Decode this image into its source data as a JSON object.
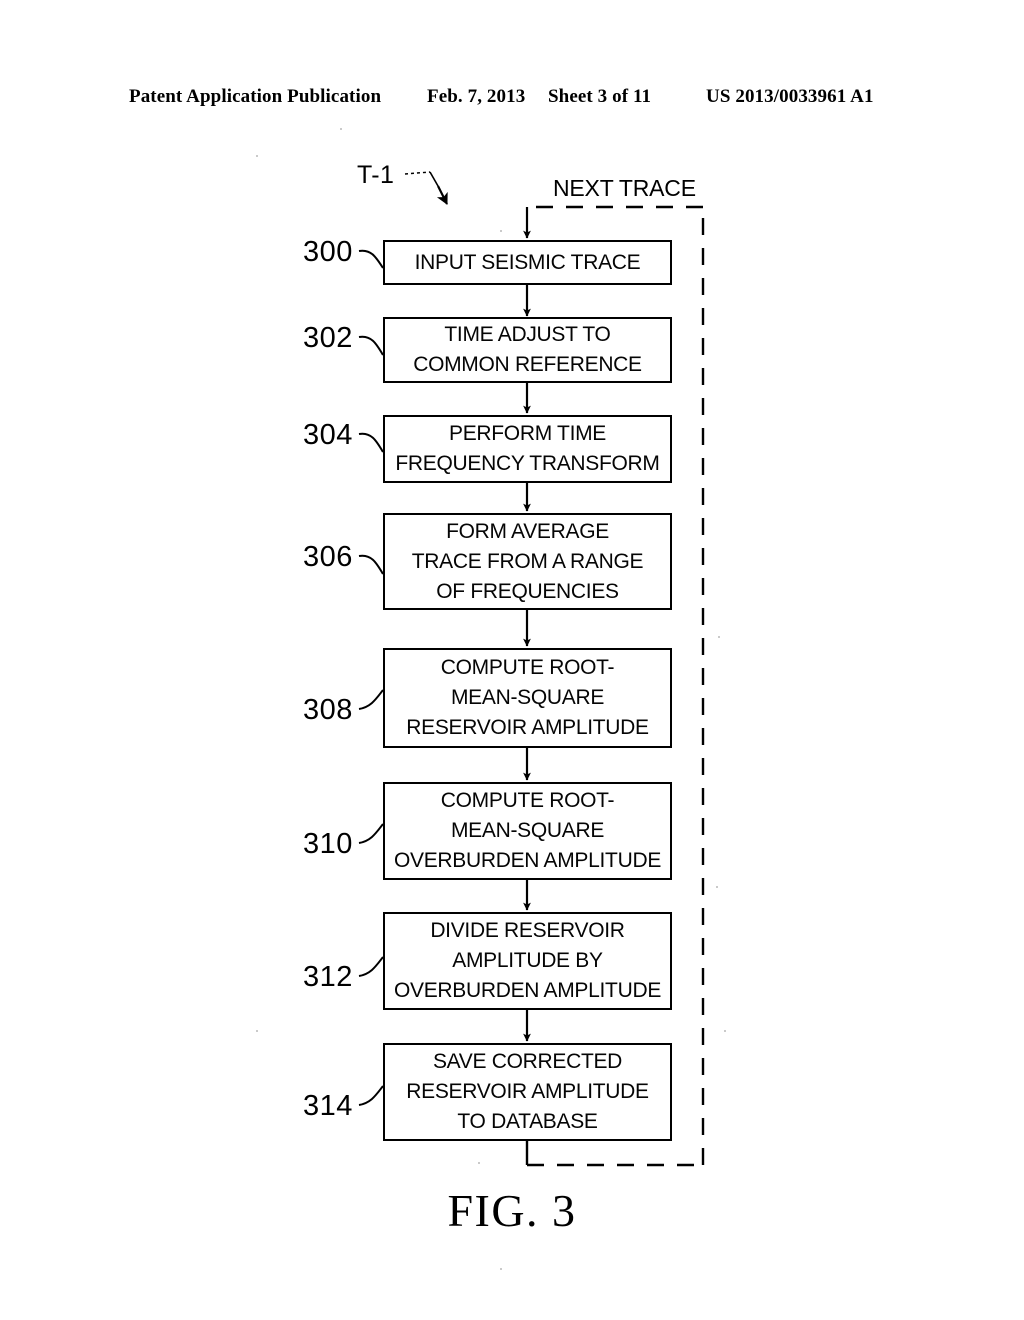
{
  "header": {
    "publication": "Patent Application Publication",
    "date": "Feb. 7, 2013",
    "sheet": "Sheet 3 of 11",
    "patent_number": "US 2013/0033961 A1"
  },
  "figure": {
    "caption": "FIG. 3",
    "process_label": "T-1",
    "loop_label": "NEXT TRACE",
    "line_color": "#000000",
    "background_color": "#ffffff"
  },
  "flowchart": {
    "steps": [
      {
        "ref": "300",
        "text": "INPUT SEISMIC TRACE"
      },
      {
        "ref": "302",
        "text": "TIME ADJUST TO\nCOMMON REFERENCE"
      },
      {
        "ref": "304",
        "text": "PERFORM TIME\nFREQUENCY TRANSFORM"
      },
      {
        "ref": "306",
        "text": "FORM AVERAGE\nTRACE FROM A RANGE\nOF FREQUENCIES"
      },
      {
        "ref": "308",
        "text": "COMPUTE ROOT-\nMEAN-SQUARE\nRESERVOIR AMPLITUDE"
      },
      {
        "ref": "310",
        "text": "COMPUTE ROOT-\nMEAN-SQUARE\nOVERBURDEN AMPLITUDE"
      },
      {
        "ref": "312",
        "text": "DIVIDE RESERVOIR\nAMPLITUDE BY\nOVERBURDEN AMPLITUDE"
      },
      {
        "ref": "314",
        "text": "SAVE CORRECTED\nRESERVOIR AMPLITUDE\nTO DATABASE"
      }
    ]
  }
}
